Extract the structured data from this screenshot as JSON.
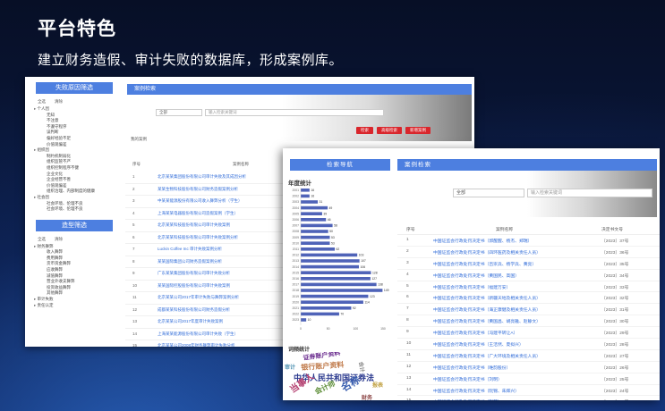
{
  "slide": {
    "title": "平台特色",
    "subtitle": "建立财务造假、审计失败的数据库，形成案例库。"
  },
  "shot1": {
    "left_panel_title": "失败原因筛选",
    "tabs": [
      "全选",
      "清除"
    ],
    "tree": [
      {
        "level": 1,
        "label": "个人因"
      },
      {
        "level": 2,
        "label": "无知"
      },
      {
        "level": 2,
        "label": "不注意"
      },
      {
        "level": 2,
        "label": "不遵守程序"
      },
      {
        "level": 2,
        "label": "误判断"
      },
      {
        "level": 2,
        "label": "偏好经验不足"
      },
      {
        "level": 2,
        "label": "价值观偏差"
      },
      {
        "level": 1,
        "label": "组织因"
      },
      {
        "level": 2,
        "label": "制约机制弱化"
      },
      {
        "level": 2,
        "label": "组织监管不严"
      },
      {
        "level": 2,
        "label": "组织控制程序不健"
      },
      {
        "level": 2,
        "label": "企业文化"
      },
      {
        "level": 2,
        "label": "企业经营不善"
      },
      {
        "level": 2,
        "label": "价值观偏差"
      },
      {
        "level": 2,
        "label": "组织治理、内部制度的健康"
      },
      {
        "level": 1,
        "label": "社会因"
      },
      {
        "level": 2,
        "label": "社会环境、伦理不良"
      },
      {
        "level": 2,
        "label": "社会环境、伦理不良"
      }
    ],
    "second_panel_title": "造型筛选",
    "tabs2": [
      "全选",
      "清除"
    ],
    "tree2": [
      {
        "level": 1,
        "label": "财务舞弊"
      },
      {
        "level": 2,
        "label": "收入舞弊"
      },
      {
        "level": 2,
        "label": "费用舞弊"
      },
      {
        "level": 2,
        "label": "货币资金舞弊"
      },
      {
        "level": 2,
        "label": "应收舞弊"
      },
      {
        "level": 2,
        "label": "减值舞弊"
      },
      {
        "level": 2,
        "label": "营业外收支舞弊"
      },
      {
        "level": 2,
        "label": "投资收益舞弊"
      },
      {
        "level": 2,
        "label": "其他舞弊"
      },
      {
        "level": 1,
        "label": "审计失败"
      },
      {
        "level": 1,
        "label": "责任认定"
      }
    ],
    "main_title": "案例检索",
    "search": {
      "select_value": "全部",
      "placeholder": "输入检索关键词"
    },
    "buttons": [
      "检索",
      "高级检索",
      "新增案例"
    ],
    "my_cases": "我的案例",
    "table_headers": [
      "序号",
      "案例名称"
    ],
    "rows": [
      {
        "no": "1",
        "name": "北京某某集团股份有限公司审计失败及其成因分析"
      },
      {
        "no": "2",
        "name": "某某生物科技股份有限公司财务造假案例分析"
      },
      {
        "no": "3",
        "name": "中某某能源股份有限公司收入舞弊分析（学生）"
      },
      {
        "no": "4",
        "name": "上海某某电器股份有限公司造假案例（学生）"
      },
      {
        "no": "5",
        "name": "北京某某科技股份有限公司审计失败案例"
      },
      {
        "no": "6",
        "name": "北京某某科技股份有限公司审计失败案例分析"
      },
      {
        "no": "7",
        "name": "Luckin Coffee Inc 审计失败案例分析"
      },
      {
        "no": "8",
        "name": "某某国际集团公司财务造假案例分析"
      },
      {
        "no": "9",
        "name": "广东某某集团股份有限公司审计失败分析"
      },
      {
        "no": "10",
        "name": "某某国际控股股份有限公司审计失败案例"
      },
      {
        "no": "11",
        "name": "北京某某公司2017年审计失败与舞弊案例分析"
      },
      {
        "no": "12",
        "name": "成都某某科技股份有限公司财务造假分析"
      },
      {
        "no": "13",
        "name": "北京某某公司2017年度审计失败案例"
      },
      {
        "no": "14",
        "name": "上海某某能源股份有限公司审计失败（学生）"
      },
      {
        "no": "15",
        "name": "北京某某公司2008年财务舞弊审计失败分析"
      }
    ]
  },
  "shot2": {
    "nav_title": "检索导航",
    "year_title": "年度统计",
    "chart_data": {
      "type": "bar",
      "orientation": "horizontal",
      "title": "",
      "categories": [
        "2001",
        "2002",
        "2003",
        "2004",
        "2005",
        "2006",
        "2007",
        "2008",
        "2009",
        "2010",
        "2011",
        "2012",
        "2013",
        "2014",
        "2015",
        "2016",
        "2017",
        "2018",
        "2019",
        "2020",
        "2021",
        "2022",
        "2023"
      ],
      "values": [
        16,
        16,
        31,
        49,
        39,
        46,
        58,
        50,
        53,
        53,
        62,
        103,
        107,
        106,
        128,
        127,
        138,
        149,
        123,
        114,
        92,
        70,
        10
      ],
      "xlim": [
        0,
        150
      ],
      "xticks": [
        "0",
        "50",
        "100",
        "150"
      ],
      "color": "#4f63b8"
    },
    "survey_title": "词频统计",
    "word_cloud": [
      {
        "text": "证券账户资料",
        "color": "#6b2d8f"
      },
      {
        "text": "银行账户资料",
        "color": "#c07a4a"
      },
      {
        "text": "中华人民共和国证券法",
        "color": "#2b3a8f"
      },
      {
        "text": "当事人",
        "color": "#b33d6e"
      },
      {
        "text": "会计师",
        "color": "#5f8f3a"
      },
      {
        "text": "名称",
        "color": "#3a5fb0"
      },
      {
        "text": "会计",
        "color": "#8a8a8a"
      },
      {
        "text": "报表",
        "color": "#c0a040"
      },
      {
        "text": "审计",
        "color": "#4a8fb0"
      },
      {
        "text": "财务",
        "color": "#8f4a4a"
      }
    ],
    "main_title": "案例检索",
    "search": {
      "select_value": "全部",
      "placeholder": "输入检索关键词"
    },
    "table_headers": [
      "序号",
      "案例名称",
      "决定书文号"
    ],
    "rows": [
      {
        "no": "1",
        "name": "中国证监会行政处罚决定书（郭醒醒、杨杰、郑瑞）",
        "doc": "〔2023〕37号"
      },
      {
        "no": "2",
        "name": "中国证监会行政处罚决定书（四环医药及相关责任人员）",
        "doc": "〔2023〕36号"
      },
      {
        "no": "3",
        "name": "中国证监会行政处罚决定书（吕崇兵、杨学兵、黄亮）",
        "doc": "〔2023〕35号"
      },
      {
        "no": "4",
        "name": "中国证监会行政处罚决定书（黄国民、高国）",
        "doc": "〔2023〕34号"
      },
      {
        "no": "5",
        "name": "中国证监会行政处罚决定书（福建万安）",
        "doc": "〔2023〕33号"
      },
      {
        "no": "6",
        "name": "中国证监会行政处罚决定书（新疆天地及相关责任人员）",
        "doc": "〔2023〕32号"
      },
      {
        "no": "7",
        "name": "中国证监会行政处罚决定书（海正康健及相关责任人员）",
        "doc": "〔2023〕31号"
      },
      {
        "no": "8",
        "name": "中国证监会行政处罚决定书（黄国昌、胡亮雅、赵静文）",
        "doc": "〔2023〕30号"
      },
      {
        "no": "9",
        "name": "中国证监会行政处罚决定书（冯建平转让A）",
        "doc": "〔2023〕29号"
      },
      {
        "no": "10",
        "name": "中国证监会行政处罚决定书（王洁然、夏拟兴）",
        "doc": "〔2023〕28号"
      },
      {
        "no": "11",
        "name": "中国证监会行政处罚决定书（广大环境及相关责任人员）",
        "doc": "〔2023〕27号"
      },
      {
        "no": "12",
        "name": "中国证监会行政处罚决定书（唯韵股份）",
        "doc": "〔2023〕26号"
      },
      {
        "no": "13",
        "name": "中国证监会行政处罚决定书（刘明）",
        "doc": "〔2023〕25号"
      },
      {
        "no": "14",
        "name": "中国证监会行政处罚决定书（阮锦、朱辉兴）",
        "doc": "〔2023〕24号"
      },
      {
        "no": "15",
        "name": "中国证监会行政处罚决定书（刘某）",
        "doc": "〔2023〕23号"
      }
    ]
  }
}
